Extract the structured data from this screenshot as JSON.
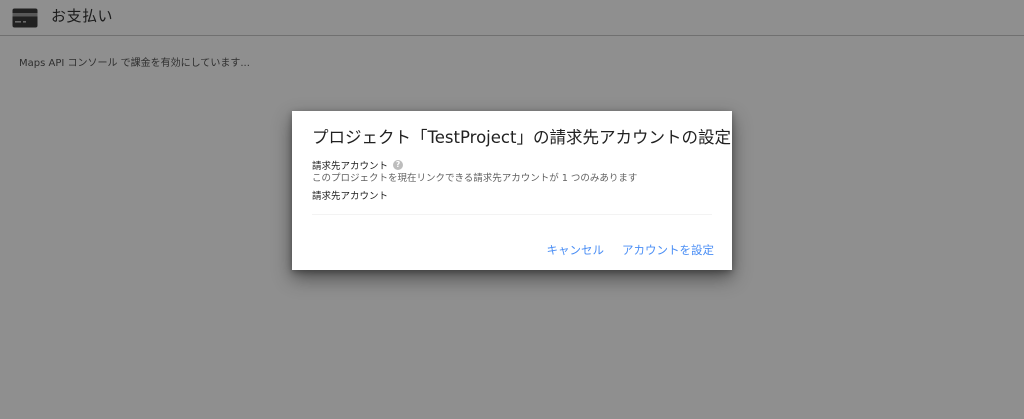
{
  "header": {
    "icon": "credit-card-icon",
    "title": "お支払い"
  },
  "status": {
    "message": "Maps API コンソール で課金を有効にしています..."
  },
  "dialog": {
    "title": "プロジェクト「TestProject」の請求先アカウントの設定",
    "billing_account_label": "請求先アカウント",
    "help_icon": "help-icon",
    "help_text": "このプロジェクトを現在リンクできる請求先アカウントが 1 つのみあります",
    "select_label": "請求先アカウント",
    "cancel_label": "キャンセル",
    "confirm_label": "アカウントを設定"
  },
  "colors": {
    "accent": "#4a8ef5",
    "overlay": "rgba(0,0,0,0.44)",
    "header_icon": "#3c3c3c"
  }
}
